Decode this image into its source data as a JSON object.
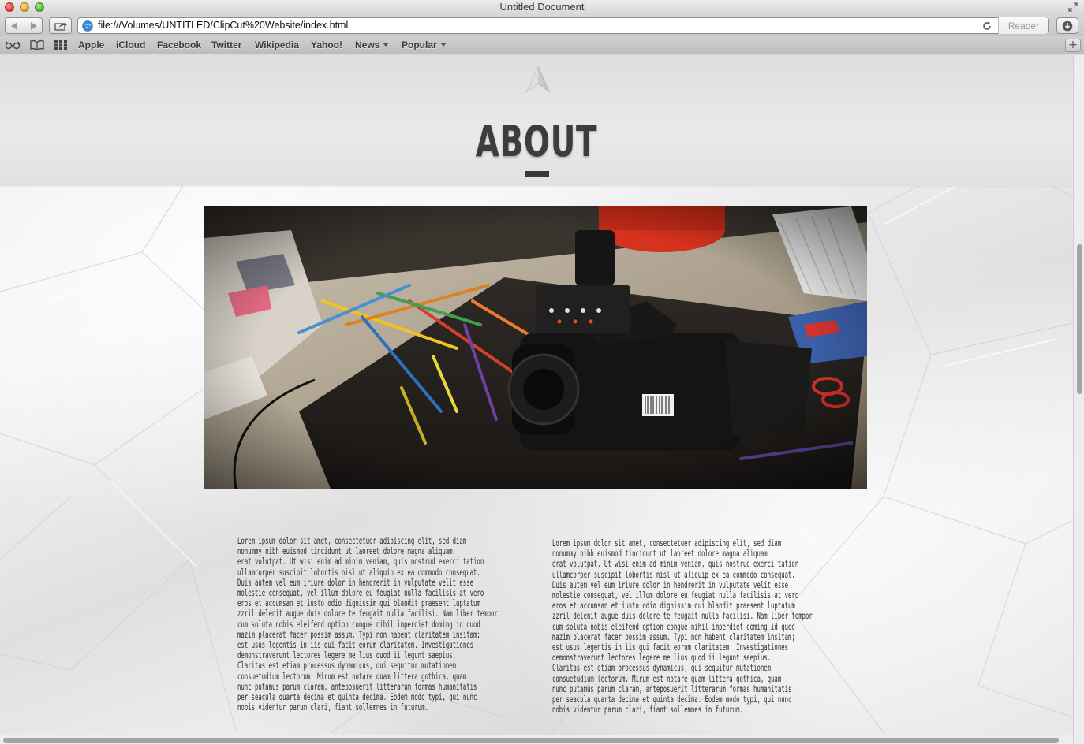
{
  "window": {
    "title": "Untitled Document"
  },
  "toolbar": {
    "url": "file:///Volumes/UNTITLED/ClipCut%20Website/index.html",
    "reader_label": "Reader"
  },
  "bookmarks": {
    "items": [
      {
        "label": "Apple"
      },
      {
        "label": "iCloud"
      },
      {
        "label": "Facebook"
      },
      {
        "label": "Twitter"
      },
      {
        "label": "Wikipedia"
      },
      {
        "label": "Yahoo!"
      },
      {
        "label": "News",
        "dropdown": true
      },
      {
        "label": "Popular",
        "dropdown": true
      }
    ]
  },
  "page": {
    "section_title": "ABOUT",
    "hero_image_alt": "camera-on-desk-photo",
    "col_left": "Lorem ipsum dolor sit amet, consectetuer adipiscing elit, sed diam\nnonummy nibh euismod tincidunt ut laoreet dolore magna aliquam\nerat volutpat. Ut wisi enim ad minim veniam, quis nostrud exerci tation\nullamcorper suscipit lobortis nisl ut aliquip ex ea commodo consequat.\nDuis autem vel eum iriure dolor in hendrerit in vulputate velit esse\nmolestie consequat, vel illum dolore eu feugiat nulla facilisis at vero\neros et accumsan et iusto odio dignissim qui blandit praesent luptatum\nzzril delenit augue duis dolore te feugait nulla facilisi. Nam liber tempor\ncum soluta nobis eleifend option congue nihil imperdiet doming id quod\nmazim placerat facer possim assum. Typi non habent claritatem insitam;\nest usus legentis in iis qui facit eorum claritatem. Investigationes\ndemonstraverunt lectores legere me lius quod ii legunt saepius.\nClaritas est etiam processus dynamicus, qui sequitur mutationem\nconsuetudium lectorum. Mirum est notare quam littera gothica, quam\nnunc putamus parum claram, anteposuerit litterarum formas humanitatis\nper seacula quarta decima et quinta decima. Eodem modo typi, qui nunc\nnobis videntur parum clari, fiant sollemnes in futurum.",
    "col_right": "Lorem ipsum dolor sit amet, consectetuer adipiscing elit, sed diam\nnonummy nibh euismod tincidunt ut laoreet dolore magna aliquam\nerat volutpat. Ut wisi enim ad minim veniam, quis nostrud exerci tation\nullamcorper suscipit lobortis nisl ut aliquip ex ea commodo consequat.\nDuis autem vel eum iriure dolor in hendrerit in vulputate velit esse\nmolestie consequat, vel illum dolore eu feugiat nulla facilisis at vero\neros et accumsan et iusto odio dignissim qui blandit praesent luptatum\nzzril delenit augue duis dolore te feugait nulla facilisi. Nam liber tempor\ncum soluta nobis eleifend option congue nihil imperdiet doming id quod\nmazim placerat facer possim assum. Typi non habent claritatem insitam;\nest usus legentis in iis qui facit eorum claritatem. Investigationes\ndemonstraverunt lectores legere me lius quod ii legunt saepius.\nClaritas est etiam processus dynamicus, qui sequitur mutationem\nconsuetudium lectorum. Mirum est notare quam littera gothica, quam\nnunc putamus parum claram, anteposuerit litterarum formas humanitatis\nper seacula quarta decima et quinta decima. Eodem modo typi, qui nunc\nnobis videntur parum clari, fiant sollemnes in futurum."
  },
  "colors": {
    "title": "#3c3c3c",
    "body_text": "#2c2c2c",
    "paper": "#ececec"
  }
}
